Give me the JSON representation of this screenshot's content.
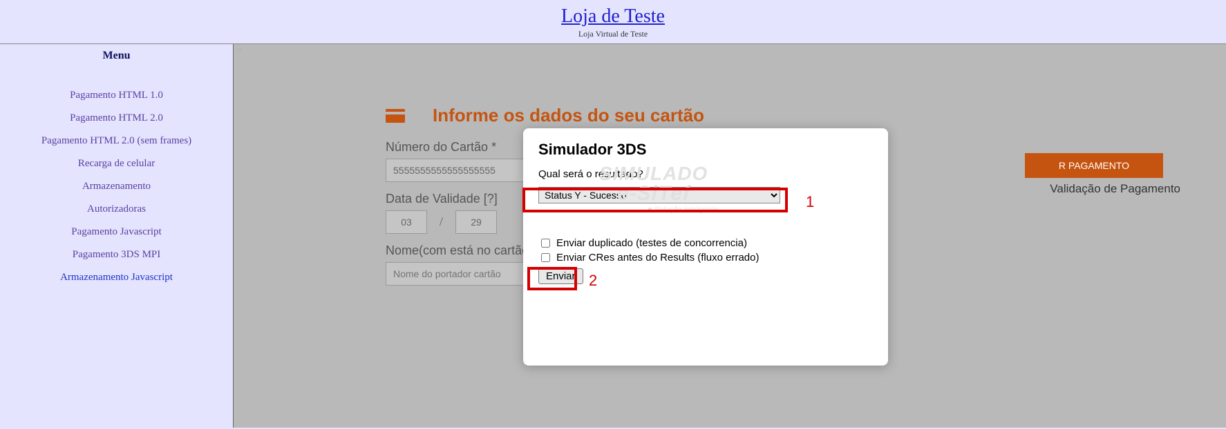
{
  "header": {
    "title": "Loja de Teste",
    "subtitle": "Loja Virtual de Teste"
  },
  "sidebar": {
    "heading": "Menu",
    "items": [
      "Pagamento HTML 1.0",
      "Pagamento HTML 2.0",
      "Pagamento HTML 2.0 (sem frames)",
      "Recarga de celular",
      "Armazenamento",
      "Autorizadoras",
      "Pagamento Javascript",
      "Pagamento 3DS MPI",
      "Armazenamento Javascript"
    ]
  },
  "form": {
    "title": "Informe os dados do seu cartão",
    "card_label": "Número do Cartão *",
    "card_value": "5555555555555555555",
    "expiry_label": "Data de Validade [?]",
    "mm": "03",
    "yy": "29",
    "name_label": "Nome(com está no cartão) *",
    "name_placeholder": "Nome do portador cartão",
    "pay_button": "R PAGAMENTO",
    "stage": "Validação de Pagamento"
  },
  "modal": {
    "title": "Simulador 3DS",
    "question": "Qual será o resultado?",
    "selected": "Status Y - Sucesso",
    "check1": "Enviar duplicado (testes de concorrencia)",
    "check2": "Enviar CRes antes do Results (fluxo errado)",
    "submit": "Enviar",
    "watermark": {
      "l1": "SIMULADO",
      "l2": "e-SiTef",
      "l3": "■ Solução inteligente"
    }
  },
  "annotations": {
    "n1": "1",
    "n2": "2"
  },
  "ghost": ">"
}
